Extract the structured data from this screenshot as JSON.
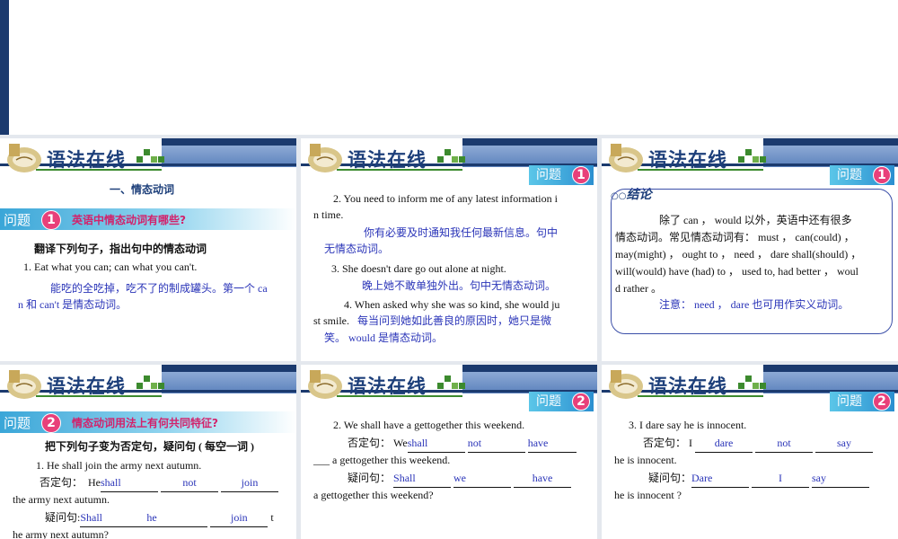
{
  "header_title": "语法在线",
  "q_label": "问题",
  "slides": {
    "s1": {
      "section": "一、情态动词",
      "q_num": "1",
      "question": "英语中情态动词有哪些?",
      "instruction": "翻译下列句子，指出句中的情态动词",
      "ex1": "1. Eat what you can; can what you can't.",
      "ans1a": "能吃的全吃掉，吃不了的制成罐头。第一个 ca",
      "ans1b": "n 和 can't 是情态动词。"
    },
    "s2": {
      "q_num": "1",
      "ex2a": "2. You need to inform me of any latest information i",
      "ex2b": "n time.",
      "ans2a": "你有必要及时通知我任何最新信息。句中",
      "ans2b": "无情态动词。",
      "ex3": "3. She doesn't dare go out alone at night.",
      "ans3": "晚上她不敢单独外出。句中无情态动词。",
      "ex4a": "4. When asked why she was so kind, she would ju",
      "ex4b_en": "st smile.",
      "ex4b_cn": "每当问到她如此善良的原因时，她只是微",
      "ex4c": "笑。 would 是情态动词。"
    },
    "s3": {
      "q_num": "1",
      "concl_label": "结论",
      "c1": "除了  can ， would 以外，英语中还有很多",
      "c2": "情态动词。常见情态动词有： must ， can(could) ，",
      "c3": "may(might) ， ought to ， need ， dare shall(should) ，",
      "c4": "will(would) have (had) to ， used to, had better ， woul",
      "c5": "d rather 。",
      "note": "注意： need ， dare 也可用作实义动词。"
    },
    "s4": {
      "q_num": "2",
      "question": "情态动词用法上有何共同特征?",
      "instruction": "把下列句子变为否定句，疑问句 ( 每空一词 )",
      "ex1": "1. He shall join the army next autumn.",
      "neg_label": "否定句：",
      "neg_pre": "He",
      "neg_fills": [
        "shall",
        "not",
        "join"
      ],
      "neg_tail": "the army next autumn.",
      "q_label": "疑问句:",
      "q_fills": [
        "Shall",
        "he",
        "join"
      ],
      "q_tail_a": "t",
      "q_tail_b": "he army next autumn?"
    },
    "s5": {
      "q_num": "2",
      "ex2": "2. We shall have a gettogether this weekend.",
      "neg_label": "否定句：",
      "neg_pre": "We",
      "neg_fills": [
        "shall",
        "not",
        "have"
      ],
      "neg_tail": "___ a gettogether this weekend.",
      "q_label": "疑问句：",
      "q_fills": [
        "Shall",
        "we",
        "have"
      ],
      "q_tail": "a gettogether this weekend?"
    },
    "s6": {
      "q_num": "2",
      "ex3": "3. I dare say he is innocent.",
      "neg_label": "否定句：",
      "neg_pre": "I",
      "neg_fills": [
        "dare",
        "not",
        "say"
      ],
      "neg_tail": "he is innocent.",
      "q_label": "疑问句：",
      "q_fills": [
        "Dare",
        "I",
        "say"
      ],
      "q_tail": "he is innocent ?"
    }
  }
}
